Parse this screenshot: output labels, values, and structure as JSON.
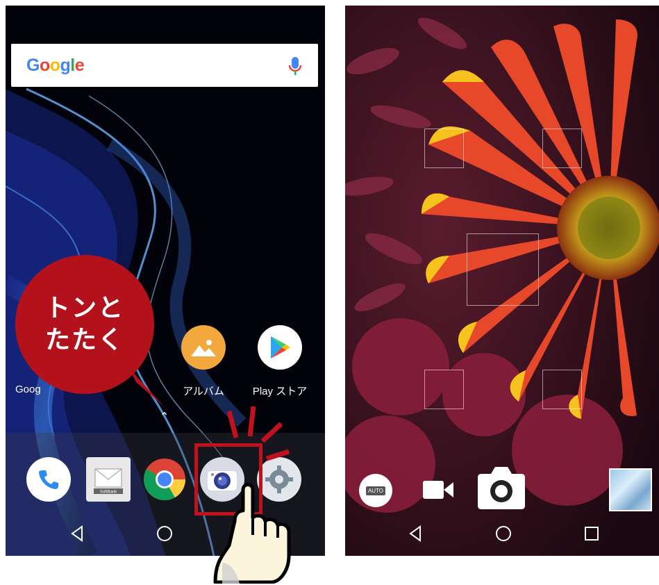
{
  "home_screen": {
    "search": {
      "logo_text": "Google",
      "icon": "mic-icon"
    },
    "apps_row": [
      {
        "label": "Goog",
        "icon": "google-folder-icon"
      },
      {
        "label": "アルバム",
        "icon": "album-icon"
      },
      {
        "label": "Play ストア",
        "icon": "play-store-icon"
      }
    ],
    "dock": [
      {
        "name": "phone",
        "icon": "phone-icon"
      },
      {
        "name": "softbank-mail",
        "icon": "mail-icon",
        "caption": "SoftBank"
      },
      {
        "name": "chrome",
        "icon": "chrome-icon"
      },
      {
        "name": "camera",
        "icon": "camera-icon"
      },
      {
        "name": "settings",
        "icon": "settings-icon"
      }
    ],
    "callout": {
      "line1": "トンと",
      "line2": "たたく",
      "color": "#b3121d"
    },
    "nav": [
      "back-icon",
      "home-icon"
    ]
  },
  "camera_screen": {
    "mode_button": "AUTO",
    "controls": [
      "video-icon",
      "shutter-icon",
      "gallery-thumbnail"
    ],
    "nav": [
      "back-icon",
      "home-icon",
      "recents-icon"
    ]
  }
}
